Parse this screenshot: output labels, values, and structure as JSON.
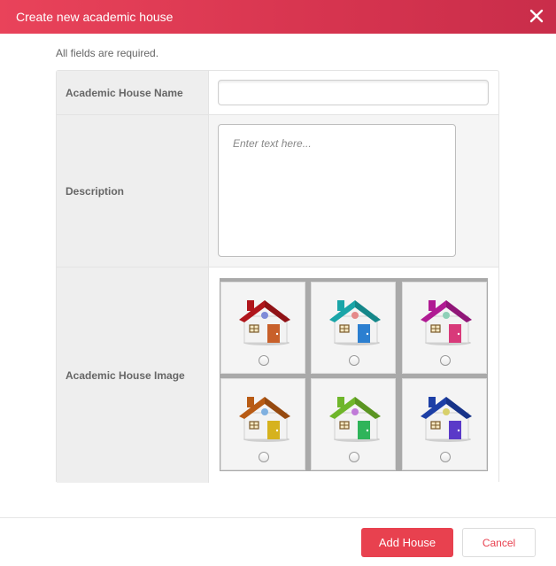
{
  "dialog": {
    "title": "Create new academic house",
    "close_icon": "close-icon"
  },
  "form": {
    "note": "All fields are required.",
    "name_label": "Academic House Name",
    "name_value": "",
    "description_label": "Description",
    "description_placeholder": "Enter text here...",
    "description_value": "",
    "image_label": "Academic House Image",
    "house_images": [
      {
        "icon": "house-icon",
        "roof": "#b0161c",
        "door": "#c8602a",
        "dot": "#7e8bd8",
        "selected": false
      },
      {
        "icon": "house-icon",
        "roof": "#1aa5a8",
        "door": "#2c7fd0",
        "dot": "#e58a8a",
        "selected": false
      },
      {
        "icon": "house-icon",
        "roof": "#b01b93",
        "door": "#d83a7a",
        "dot": "#8fd0b8",
        "selected": false
      },
      {
        "icon": "house-icon",
        "roof": "#b85b14",
        "door": "#d6b21e",
        "dot": "#7fb0e0",
        "selected": false
      },
      {
        "icon": "house-icon",
        "roof": "#6fb62a",
        "door": "#2fb45a",
        "dot": "#c07ad8",
        "selected": false
      },
      {
        "icon": "house-icon",
        "roof": "#1d3fa6",
        "door": "#5a3ac8",
        "dot": "#d8d06a",
        "selected": false
      }
    ]
  },
  "footer": {
    "add_label": "Add House",
    "cancel_label": "Cancel"
  },
  "colors": {
    "accent": "#e8414f",
    "header_gradient_start": "#e9435a",
    "header_gradient_end": "#c92d4a"
  }
}
